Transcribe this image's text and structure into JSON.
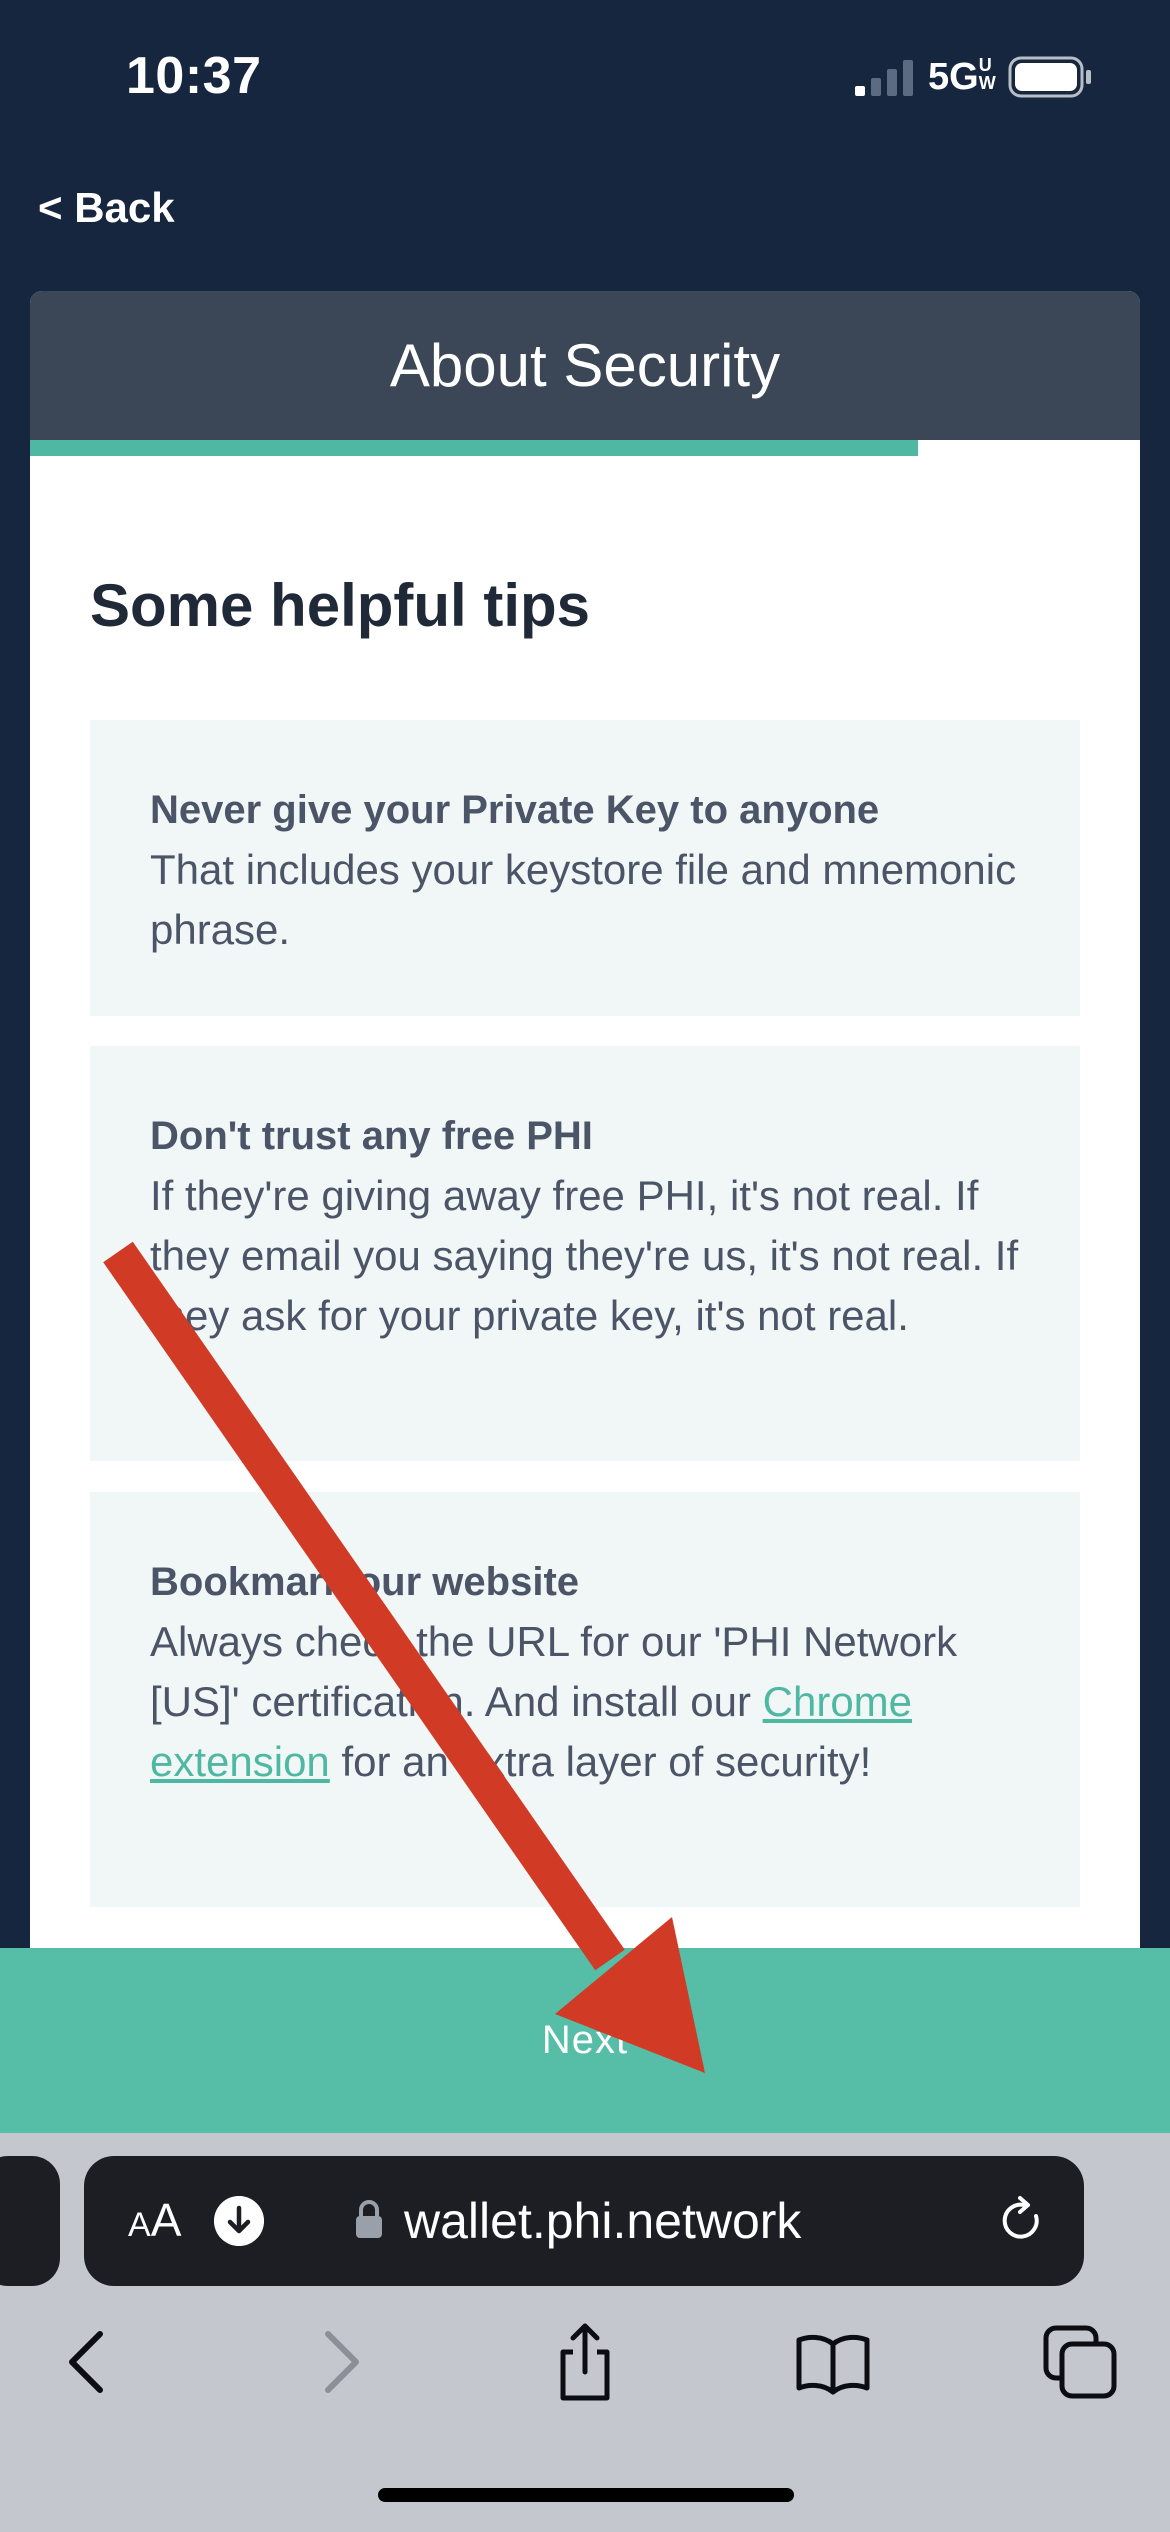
{
  "status_bar": {
    "time": "10:37",
    "network": "5G",
    "network_suffix": "UW"
  },
  "nav": {
    "back_label": "< Back"
  },
  "card": {
    "title": "About Security",
    "progress": 0.8,
    "heading": "Some helpful tips",
    "tips": [
      {
        "title": "Never give your Private Key to anyone",
        "body": "That includes your keystore file and mnemonic phrase."
      },
      {
        "title": "Don't trust any free PHI",
        "body": "If they're giving away free PHI, it's not real. If they email you saying they're us, it's not real. If they ask for your private key, it's not real."
      },
      {
        "title": "Bookmark our website",
        "body_before": "Always check the URL for our 'PHI Network [US]' certification. And install our ",
        "link_text": "Chrome extension",
        "body_after": " for an extra layer of security!"
      }
    ]
  },
  "next_button": {
    "label": "Next"
  },
  "browser": {
    "aa_label_small": "A",
    "aa_label_large": "A",
    "url": "wallet.phi.network"
  },
  "colors": {
    "accent": "#4fb8a3",
    "next_bar": "#56bda6",
    "header": "#3b4756",
    "page_bg": "#16263f",
    "annotation_arrow": "#d13b26"
  },
  "icons": {
    "download": "download-icon",
    "lock": "lock-icon",
    "reload": "reload-icon",
    "back": "chevron-left-icon",
    "forward": "chevron-right-icon",
    "share": "share-icon",
    "bookmarks": "book-icon",
    "tabs": "tabs-icon"
  }
}
